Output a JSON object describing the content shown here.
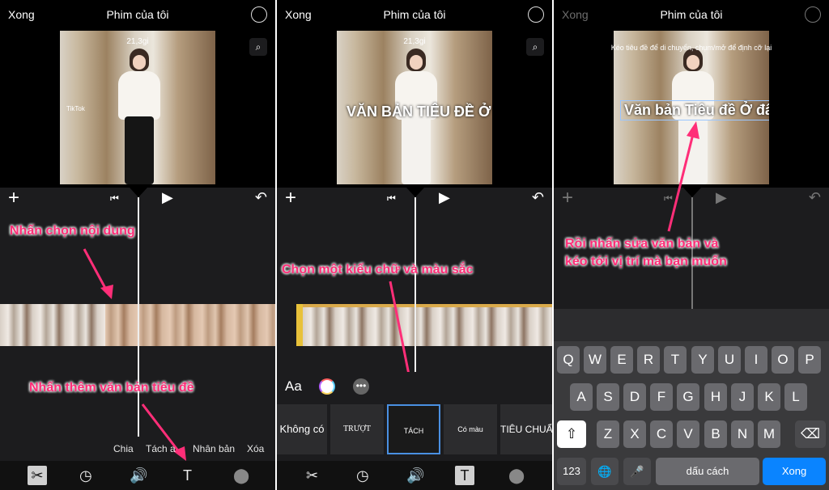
{
  "nav": {
    "done": "Xong",
    "title": "Phim của tôi",
    "help": "?"
  },
  "panel1": {
    "timestamp": "21,3gi",
    "watermark": "TikTok",
    "callout_top": "Nhấn chọn nội dung",
    "callout_bottom": "Nhấn thêm văn bản tiêu đề",
    "actions": [
      "Chia",
      "Tách a",
      "Nhân bản",
      "Xóa"
    ]
  },
  "panel2": {
    "timestamp": "21,3gi",
    "title_text": "VĂN BẢN TIÊU ĐỀ Ở ĐÂY",
    "callout": "Chọn một kiểu chữ và màu sắc",
    "font_label": "Aa",
    "more_label": "•••",
    "styles": [
      "Không có",
      "TRƯỢT",
      "TÁCH",
      "Có màu",
      "TIÊU CHUẨ"
    ]
  },
  "panel3": {
    "instruction": "Kéo tiêu đề để di chuyển, chụm/mở để định cỡ lại",
    "title_text": "Văn bản Tiêu đề Ở đây",
    "callout_line1": "Rồi nhấn sửa văn bản và",
    "callout_line2": "kéo tới vị trí mà bạn muốn",
    "keyboard": {
      "row1": [
        "Q",
        "W",
        "E",
        "R",
        "T",
        "Y",
        "U",
        "I",
        "O",
        "P"
      ],
      "row2": [
        "A",
        "S",
        "D",
        "F",
        "G",
        "H",
        "J",
        "K",
        "L"
      ],
      "row3": [
        "Z",
        "X",
        "C",
        "V",
        "B",
        "N",
        "M"
      ],
      "numbers": "123",
      "space": "dấu cách",
      "enter": "Xong"
    }
  },
  "icons": {
    "plus": "+",
    "skip": "⏮",
    "play": "▶",
    "undo": "↶",
    "scissors": "✂",
    "speed": "◷",
    "volume": "🔊",
    "text": "T",
    "filters": "⬤",
    "zoom": "⌕",
    "shift": "⇧",
    "backspace": "⌫",
    "globe": "🌐",
    "mic": "🎤"
  },
  "colors": {
    "callout": "#ff2e78",
    "enter_key": "#0a84ff",
    "selected_tile": "#4a90e2"
  }
}
